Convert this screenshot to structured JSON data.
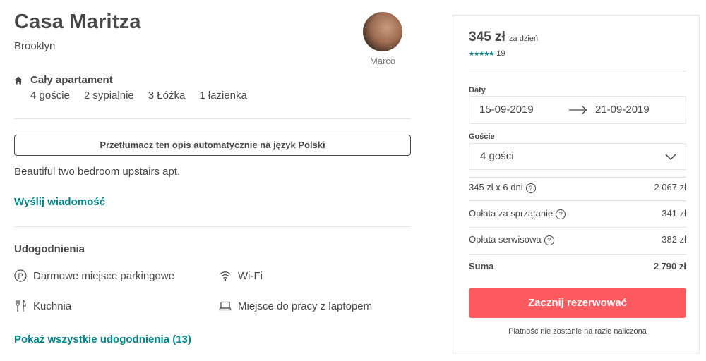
{
  "listing": {
    "title": "Casa Maritza",
    "city": "Brooklyn",
    "host_name": "Marco",
    "room_type": "Cały apartament",
    "specs": [
      "4 goście",
      "2 sypialnie",
      "3 Łóżka",
      "1 łazienka"
    ],
    "translate_button": "Przetłumacz ten opis automatycznie na język Polski",
    "description": "Beautiful two bedroom upstairs apt.",
    "contact_link": "Wyślij wiadomość"
  },
  "amenities": {
    "title": "Udogodnienia",
    "items": [
      {
        "label": "Darmowe miejsce parkingowe",
        "icon": "parking-icon"
      },
      {
        "label": "Wi-Fi",
        "icon": "wifi-icon"
      },
      {
        "label": "Kuchnia",
        "icon": "kitchen-icon"
      },
      {
        "label": "Miejsce do pracy z laptopem",
        "icon": "laptop-icon"
      }
    ],
    "show_all": "Pokaż wszystkie udogodnienia (13)"
  },
  "booking": {
    "price": "345 zł",
    "price_unit": "za dzień",
    "rating_stars": 4.5,
    "review_count": "19",
    "dates_label": "Daty",
    "check_in": "15-09-2019",
    "check_out": "21-09-2019",
    "guests_label": "Goście",
    "guests_value": "4 gości",
    "lines": [
      {
        "label": "345 zł x 6 dni",
        "value": "2 067 zł"
      },
      {
        "label": "Opłata za sprzątanie",
        "value": "341 zł"
      },
      {
        "label": "Opłata serwisowa",
        "value": "382 zł"
      }
    ],
    "total_label": "Suma",
    "total_value": "2 790 zł",
    "reserve_button": "Zacznij rezerwować",
    "note": "Płatność nie zostanie na razie naliczona"
  },
  "colors": {
    "accent": "#008489",
    "button": "#ff5a5f",
    "text": "#484848"
  }
}
